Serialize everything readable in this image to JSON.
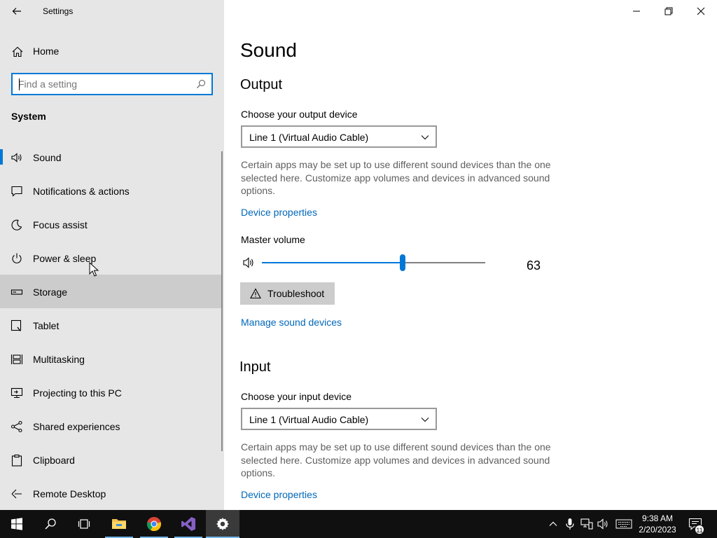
{
  "window": {
    "title": "Settings",
    "controls": [
      "minimize-icon",
      "restore-icon",
      "close-icon"
    ]
  },
  "sidebar": {
    "home_label": "Home",
    "search": {
      "placeholder": "Find a setting",
      "value": ""
    },
    "section_title": "System",
    "items": [
      {
        "label": "Sound",
        "icon": "speaker-icon",
        "selected": true
      },
      {
        "label": "Notifications & actions",
        "icon": "notification-icon"
      },
      {
        "label": "Focus assist",
        "icon": "moon-icon"
      },
      {
        "label": "Power & sleep",
        "icon": "power-icon"
      },
      {
        "label": "Storage",
        "icon": "storage-icon",
        "hover": true
      },
      {
        "label": "Tablet",
        "icon": "tablet-icon"
      },
      {
        "label": "Multitasking",
        "icon": "multitasking-icon"
      },
      {
        "label": "Projecting to this PC",
        "icon": "projecting-icon"
      },
      {
        "label": "Shared experiences",
        "icon": "shared-experiences-icon"
      },
      {
        "label": "Clipboard",
        "icon": "clipboard-icon"
      },
      {
        "label": "Remote Desktop",
        "icon": "remote-desktop-icon"
      }
    ]
  },
  "main": {
    "page_title": "Sound",
    "output": {
      "heading": "Output",
      "device_label": "Choose your output device",
      "device_value": "Line 1 (Virtual Audio Cable)",
      "description": "Certain apps may be set up to use different sound devices than the one selected here. Customize app volumes and devices in advanced sound options.",
      "device_properties_link": "Device properties",
      "master_volume_label": "Master volume",
      "master_volume_value": "63",
      "master_volume_level": 0.63,
      "troubleshoot_label": "Troubleshoot",
      "manage_link": "Manage sound devices"
    },
    "input": {
      "heading": "Input",
      "device_label": "Choose your input device",
      "device_value": "Line 1 (Virtual Audio Cable)",
      "description": "Certain apps may be set up to use different sound devices than the one selected here. Customize app volumes and devices in advanced sound options.",
      "device_properties_link": "Device properties"
    }
  },
  "taskbar": {
    "apps": [
      "start-icon",
      "search-icon",
      "task-view-icon",
      "file-explorer-icon",
      "chrome-icon",
      "visual-studio-icon",
      "settings-icon"
    ],
    "clock_time": "9:38 AM",
    "clock_date": "2/20/2023",
    "notification_count": "11",
    "accent_color": "#0078d7"
  }
}
